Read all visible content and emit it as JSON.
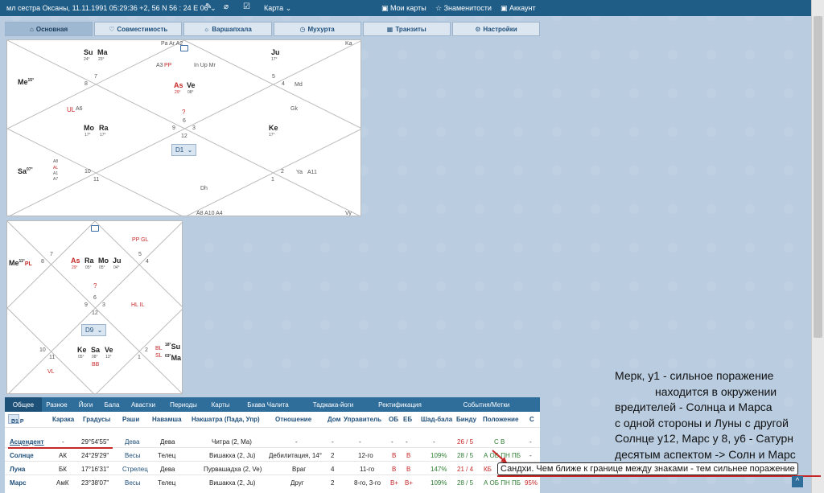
{
  "topbar": {
    "person": "мл сестра Оксаны, 11.11.1991 05:29:36 +2, 56 N 56 : 24 E 06",
    "chevron": "⌄",
    "karta": "Карта",
    "my_maps": "Мои карты",
    "celebrities": "Знаменитости",
    "account": "Аккаунт",
    "icons": [
      "pencil-icon",
      "tag-icon",
      "edit-box-icon",
      "map-icon",
      "star-icon",
      "user-icon"
    ]
  },
  "tabs": [
    "Основная",
    "Совместимость",
    "Варшапхала",
    "Мухурта",
    "Транзиты",
    "Настройки"
  ],
  "d1": {
    "select": "D1",
    "corner_tl": "",
    "top_small": "Pa Ar  A2",
    "ka": "Ka",
    "su": "Su",
    "su_deg": "24°",
    "ma": "Ma",
    "ma_deg": "23°",
    "a3pp": "A3",
    "pp": "PP",
    "inupmr": "In Up Mr",
    "ju": "Ju",
    "ju_deg": "17°",
    "me": "Me",
    "me_deg": "15°",
    "n7": "7",
    "n8": "8",
    "n5": "5",
    "n4": "4",
    "md": "Md",
    "as": "As",
    "as_deg": "29°",
    "ve": "Ve",
    "ve_deg": "08°",
    "ul": "UL",
    "a6": "A6",
    "q": "?",
    "gk": "Gk",
    "mo": "Mo",
    "mo_deg": "17°",
    "ra": "Ra",
    "ra_deg": "17°",
    "n6": "6",
    "n9": "9",
    "n3": "3",
    "n12": "12",
    "ke": "Ke",
    "ke_deg": "17°",
    "sa": "Sa",
    "sa_deg": "07°",
    "a8": "A8",
    "al": "AL",
    "a1": "A1",
    "a7": "A7",
    "n10": "10",
    "n11": "11",
    "n2": "2",
    "n1": "1",
    "ya": "Ya",
    "a11": "A11",
    "dh": "Dh",
    "bottom": "A8 A10 A4",
    "vy": "Vy"
  },
  "d9": {
    "select": "D9",
    "pp_gl": "PP GL",
    "me": "Me",
    "me_deg": "11°",
    "pl": "PL",
    "n7": "7",
    "n8": "8",
    "n5": "5",
    "n4": "4",
    "as": "As",
    "as_deg": "29°",
    "ra": "Ra",
    "ra_deg": "05°",
    "mo": "Mo",
    "mo_deg": "05°",
    "ju": "Ju",
    "ju_deg": "04°",
    "q": "?",
    "n6": "6",
    "n9": "9",
    "n3": "3",
    "n12": "12",
    "hl_il": "HL IL",
    "n10": "10",
    "n11": "11",
    "vl": "VL",
    "ke": "Ke",
    "ke_deg": "05°",
    "sa": "Sa",
    "sa_deg": "08°",
    "ve": "Ve",
    "ve_deg": "13°",
    "bb": "BB",
    "n2": "2",
    "n1": "1",
    "bl": "BL",
    "sl": "SL",
    "su": "Su",
    "su_deg": "18°",
    "ma": "Ma",
    "ma_deg": "03°"
  },
  "table_tabs": [
    "Общее",
    "Разное",
    "Йоги",
    "Бала",
    "Авастхи",
    "Периоды",
    "Карты",
    "Бхава Чалита",
    "Таджака-йоги",
    "Ректификация",
    "События/Метки"
  ],
  "table": {
    "select": "D1 Р",
    "headers": [
      "Карака",
      "Градусы",
      "Раши",
      "Навамша",
      "Накшатра (Пада, Упр)",
      "Отношение",
      "Дом",
      "Управитель",
      "ОБ",
      "ЕБ",
      "Шад-бала",
      "Бинду",
      "Положение",
      "С"
    ],
    "rows": [
      {
        "name": "Асцендент",
        "karaka": "-",
        "deg": "29°54'55\"",
        "rashi": "Дева",
        "navamsha": "Дева",
        "nakshatra": "Читра (2, Ma)",
        "relation": "-",
        "house": "-",
        "lord": "-",
        "ob": "-",
        "eb": "-",
        "shad": "-",
        "bindu": "26 / 5",
        "pos": "С В",
        "c": "-"
      },
      {
        "name": "Солнце",
        "karaka": "АК",
        "deg": "24°29'29\"",
        "rashi": "Весы",
        "navamsha": "Телец",
        "nakshatra": "Вишакха (2, Ju)",
        "relation": "Дебилитация, 14°",
        "house": "2",
        "lord": "12-го",
        "ob": "В",
        "eb": "В",
        "shad": "109%",
        "bindu": "28 / 5",
        "pos": "А ОБ ПН ПБ",
        "c": "-"
      },
      {
        "name": "Луна",
        "karaka": "БК",
        "deg": "17°16'31\"",
        "rashi": "Стрелец",
        "navamsha": "Дева",
        "nakshatra": "Пурвашадха (2, Ve)",
        "relation": "Враг",
        "house": "4",
        "lord": "11-го",
        "ob": "В",
        "eb": "В",
        "shad": "147%",
        "bindu": "21 / 4",
        "pos": "КБ",
        "c": ""
      },
      {
        "name": "Марс",
        "karaka": "АмК",
        "deg": "23°38'07\"",
        "rashi": "Весы",
        "navamsha": "Телец",
        "nakshatra": "Вишакха (2, Ju)",
        "relation": "Друг",
        "house": "2",
        "lord": "8-го, 3-го",
        "ob": "В+",
        "eb": "В+",
        "shad": "109%",
        "bindu": "28 / 5",
        "pos": "А ОБ ПН ПБ",
        "c": "95%"
      }
    ]
  },
  "note": [
    "Мерк, у1 - сильное поражение",
    "находится в окружении",
    "вредителей - Солнца и Марса",
    "с одной стороны и Луны с другой",
    "Солнце у12, Марс у 8, у6 - Сатурн",
    "десятым аспектом -> Солн и Марс"
  ],
  "tooltip": "Сандхи. Чем ближе к границе между знаками - тем сильнее поражение",
  "up_icon": "^"
}
